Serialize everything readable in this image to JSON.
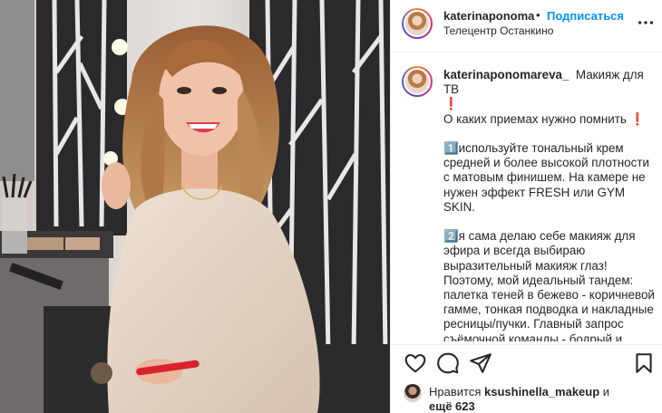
{
  "header": {
    "username": "katerinaponoma",
    "separator": "•",
    "follow_label": "Подписаться",
    "location": "Телецентр Останкино",
    "more_icon": "more-horizontal-icon"
  },
  "caption": {
    "username": "katerinaponomareva_",
    "text": "Макияж для ТВ\n❗️\nО каких приемах нужно помнить ❗️\n\n1️⃣используйте тональный крем средней и более высокой плотности с матовым финишем. На камере не нужен эффект FRESH или GYM SKIN.\n\n2️⃣я сама делаю себе макияж для эфира и всегда выбираю выразительный макияж глаз! Поэтому, мой идеальный тандем: палетка теней в бежево - коричневой гамме, тонкая подводка и накладные ресницы/пучки. Главный запрос съёмочной команды - бодрый и открытый взгляд!"
  },
  "actions": {
    "like_icon": "heart-icon",
    "comment_icon": "comment-icon",
    "share_icon": "share-icon",
    "save_icon": "bookmark-icon"
  },
  "likes": {
    "prefix": "Нравится",
    "user": "ksushinella_makeup",
    "and": "и",
    "others": "ещё 623"
  },
  "colors": {
    "link": "#0095f6",
    "text": "#262626",
    "border": "#efefef"
  }
}
